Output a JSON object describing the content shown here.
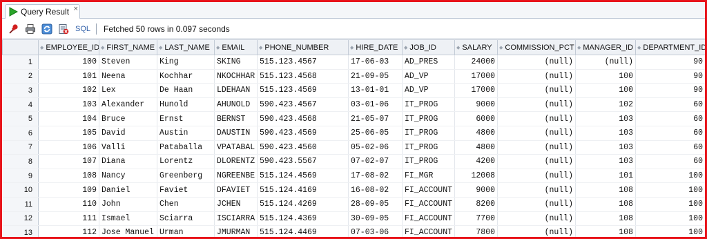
{
  "tab": {
    "label": "Query Result",
    "icon": "run-triangle-icon",
    "close": "×",
    "accent": "#2aa52a"
  },
  "toolbar": {
    "sql_label": "SQL",
    "status": "Fetched 50 rows in 0.097 seconds"
  },
  "columns": [
    "EMPLOYEE_ID",
    "FIRST_NAME",
    "LAST_NAME",
    "EMAIL",
    "PHONE_NUMBER",
    "HIRE_DATE",
    "JOB_ID",
    "SALARY",
    "COMMISSION_PCT",
    "MANAGER_ID",
    "DEPARTMENT_ID"
  ],
  "rows": [
    [
      "1",
      "100",
      "Steven",
      "King",
      "SKING",
      "515.123.4567",
      "17-06-03",
      "AD_PRES",
      "24000",
      "(null)",
      "(null)",
      "90"
    ],
    [
      "2",
      "101",
      "Neena",
      "Kochhar",
      "NKOCHHAR",
      "515.123.4568",
      "21-09-05",
      "AD_VP",
      "17000",
      "(null)",
      "100",
      "90"
    ],
    [
      "3",
      "102",
      "Lex",
      "De Haan",
      "LDEHAAN",
      "515.123.4569",
      "13-01-01",
      "AD_VP",
      "17000",
      "(null)",
      "100",
      "90"
    ],
    [
      "4",
      "103",
      "Alexander",
      "Hunold",
      "AHUNOLD",
      "590.423.4567",
      "03-01-06",
      "IT_PROG",
      "9000",
      "(null)",
      "102",
      "60"
    ],
    [
      "5",
      "104",
      "Bruce",
      "Ernst",
      "BERNST",
      "590.423.4568",
      "21-05-07",
      "IT_PROG",
      "6000",
      "(null)",
      "103",
      "60"
    ],
    [
      "6",
      "105",
      "David",
      "Austin",
      "DAUSTIN",
      "590.423.4569",
      "25-06-05",
      "IT_PROG",
      "4800",
      "(null)",
      "103",
      "60"
    ],
    [
      "7",
      "106",
      "Valli",
      "Pataballa",
      "VPATABAL",
      "590.423.4560",
      "05-02-06",
      "IT_PROG",
      "4800",
      "(null)",
      "103",
      "60"
    ],
    [
      "8",
      "107",
      "Diana",
      "Lorentz",
      "DLORENTZ",
      "590.423.5567",
      "07-02-07",
      "IT_PROG",
      "4200",
      "(null)",
      "103",
      "60"
    ],
    [
      "9",
      "108",
      "Nancy",
      "Greenberg",
      "NGREENBE",
      "515.124.4569",
      "17-08-02",
      "FI_MGR",
      "12008",
      "(null)",
      "101",
      "100"
    ],
    [
      "10",
      "109",
      "Daniel",
      "Faviet",
      "DFAVIET",
      "515.124.4169",
      "16-08-02",
      "FI_ACCOUNT",
      "9000",
      "(null)",
      "108",
      "100"
    ],
    [
      "11",
      "110",
      "John",
      "Chen",
      "JCHEN",
      "515.124.4269",
      "28-09-05",
      "FI_ACCOUNT",
      "8200",
      "(null)",
      "108",
      "100"
    ],
    [
      "12",
      "111",
      "Ismael",
      "Sciarra",
      "ISCIARRA",
      "515.124.4369",
      "30-09-05",
      "FI_ACCOUNT",
      "7700",
      "(null)",
      "108",
      "100"
    ],
    [
      "13",
      "112",
      "Jose Manuel",
      "Urman",
      "JMURMAN",
      "515.124.4469",
      "07-03-06",
      "FI_ACCOUNT",
      "7800",
      "(null)",
      "108",
      "100"
    ]
  ],
  "colors": {
    "frame_border": "#e8141b",
    "header_bg": "#eef1f5",
    "sql_link": "#2f5fa8"
  },
  "icons": [
    "pin-icon",
    "print-icon",
    "refresh-icon",
    "export-icon"
  ]
}
